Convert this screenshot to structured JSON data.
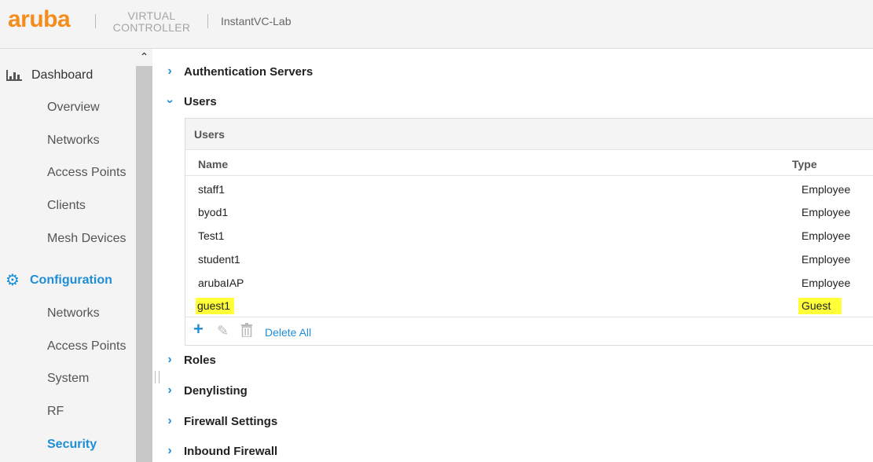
{
  "header": {
    "logo": "aruba",
    "product_line1": "VIRTUAL",
    "product_line2": "CONTROLLER",
    "controller_name": "InstantVC-Lab"
  },
  "sidebar": {
    "scroll_up": "^",
    "dashboard": {
      "label": "Dashboard",
      "items": [
        "Overview",
        "Networks",
        "Access Points",
        "Clients",
        "Mesh Devices"
      ]
    },
    "configuration": {
      "label": "Configuration",
      "items": [
        "Networks",
        "Access Points",
        "System",
        "RF",
        "Security"
      ],
      "active": "Security"
    }
  },
  "main": {
    "sections": {
      "auth_servers": "Authentication Servers",
      "users": "Users",
      "roles": "Roles",
      "denylisting": "Denylisting",
      "firewall": "Firewall Settings",
      "inbound": "Inbound Firewall"
    },
    "users_panel": {
      "title": "Users",
      "columns": {
        "name": "Name",
        "type": "Type"
      },
      "rows": [
        {
          "name": "staff1",
          "type": "Employee"
        },
        {
          "name": "byod1",
          "type": "Employee"
        },
        {
          "name": "Test1",
          "type": "Employee"
        },
        {
          "name": "student1",
          "type": "Employee"
        },
        {
          "name": "arubaIAP",
          "type": "Employee"
        },
        {
          "name": "guest1",
          "type": "Guest",
          "highlighted": true
        }
      ],
      "delete_all": "Delete All"
    }
  },
  "colors": {
    "brand_orange": "#f48d1d",
    "accent_blue": "#1f8ed6",
    "highlight_yellow": "#ffff3a"
  }
}
